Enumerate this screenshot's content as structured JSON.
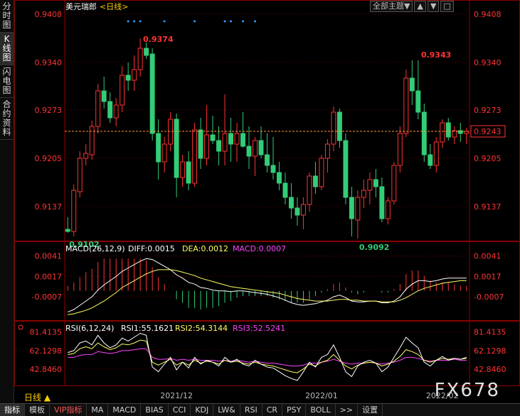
{
  "sidebar": {
    "tabs": [
      {
        "label": "分时图",
        "active": false
      },
      {
        "label": "K线图",
        "active": true
      },
      {
        "label": "闪电图",
        "active": false
      },
      {
        "label": "合约资料",
        "active": false
      }
    ]
  },
  "header": {
    "symbol": "美元瑞郎",
    "period": "<日线>",
    "dropdown_label": "全部主题▼",
    "btn_up": "▲",
    "btn_down": "▼",
    "btn_close": "□"
  },
  "chart_data": [
    {
      "type": "candlestick",
      "yticks": [
        "0.9408",
        "0.9340",
        "0.9273",
        "0.9205",
        "0.9137"
      ],
      "ylim": [
        0.9092,
        0.942
      ],
      "current_price": "0.9243",
      "annotations": {
        "high": "0.9374",
        "high2": "0.9343",
        "low1": "0.9102",
        "low2": "0.9092"
      },
      "xlabels": [
        "2021/12",
        "2022/01",
        "2022/02"
      ],
      "ohlc": [
        [
          0.9105,
          0.9122,
          0.91,
          0.9102
        ],
        [
          0.9102,
          0.9168,
          0.9095,
          0.916
        ],
        [
          0.9158,
          0.9215,
          0.915,
          0.9205
        ],
        [
          0.9205,
          0.9225,
          0.9195,
          0.9212
        ],
        [
          0.921,
          0.9258,
          0.9203,
          0.925
        ],
        [
          0.925,
          0.931,
          0.924,
          0.93
        ],
        [
          0.93,
          0.932,
          0.9275,
          0.9285
        ],
        [
          0.9285,
          0.9298,
          0.9255,
          0.9262
        ],
        [
          0.9262,
          0.929,
          0.925,
          0.928
        ],
        [
          0.928,
          0.9335,
          0.927,
          0.9322
        ],
        [
          0.9322,
          0.934,
          0.93,
          0.9315
        ],
        [
          0.9315,
          0.935,
          0.93,
          0.933
        ],
        [
          0.933,
          0.9374,
          0.932,
          0.936
        ],
        [
          0.936,
          0.9368,
          0.9345,
          0.935
        ],
        [
          0.9352,
          0.936,
          0.923,
          0.924
        ],
        [
          0.924,
          0.926,
          0.9175,
          0.92
        ],
        [
          0.92,
          0.9235,
          0.9185,
          0.9225
        ],
        [
          0.9225,
          0.927,
          0.9215,
          0.926
        ],
        [
          0.926,
          0.9268,
          0.915,
          0.9178
        ],
        [
          0.9178,
          0.921,
          0.9165,
          0.92
        ],
        [
          0.92,
          0.9215,
          0.916,
          0.917
        ],
        [
          0.917,
          0.9255,
          0.9165,
          0.9245
        ],
        [
          0.9245,
          0.9262,
          0.919,
          0.9205
        ],
        [
          0.9205,
          0.928,
          0.9195,
          0.9238
        ],
        [
          0.9238,
          0.9265,
          0.9225,
          0.923
        ],
        [
          0.923,
          0.925,
          0.9195,
          0.9215
        ],
        [
          0.9215,
          0.9295,
          0.9195,
          0.924
        ],
        [
          0.924,
          0.9262,
          0.92,
          0.9225
        ],
        [
          0.9225,
          0.9255,
          0.92,
          0.924
        ],
        [
          0.924,
          0.927,
          0.922,
          0.9222
        ],
        [
          0.9222,
          0.925,
          0.919,
          0.9208
        ],
        [
          0.9208,
          0.9235,
          0.918,
          0.923
        ],
        [
          0.923,
          0.925,
          0.9205,
          0.921
        ],
        [
          0.921,
          0.924,
          0.9185,
          0.9195
        ],
        [
          0.9195,
          0.9235,
          0.9175,
          0.9185
        ],
        [
          0.9185,
          0.92,
          0.916,
          0.917
        ],
        [
          0.917,
          0.9185,
          0.914,
          0.915
        ],
        [
          0.915,
          0.917,
          0.912,
          0.9135
        ],
        [
          0.9135,
          0.915,
          0.911,
          0.9125
        ],
        [
          0.9125,
          0.915,
          0.9105,
          0.914
        ],
        [
          0.914,
          0.9185,
          0.913,
          0.918
        ],
        [
          0.918,
          0.92,
          0.9155,
          0.9165
        ],
        [
          0.9165,
          0.921,
          0.916,
          0.9205
        ],
        [
          0.9205,
          0.9232,
          0.9185,
          0.9225
        ],
        [
          0.9225,
          0.9278,
          0.9215,
          0.927
        ],
        [
          0.927,
          0.9275,
          0.922,
          0.923
        ],
        [
          0.923,
          0.924,
          0.914,
          0.915
        ],
        [
          0.915,
          0.9165,
          0.9095,
          0.912
        ],
        [
          0.9118,
          0.916,
          0.9092,
          0.915
        ],
        [
          0.915,
          0.9175,
          0.9135,
          0.916
        ],
        [
          0.916,
          0.9185,
          0.914,
          0.9175
        ],
        [
          0.9175,
          0.919,
          0.915,
          0.9165
        ],
        [
          0.9165,
          0.9178,
          0.9115,
          0.912
        ],
        [
          0.912,
          0.915,
          0.9112,
          0.9145
        ],
        [
          0.9145,
          0.92,
          0.914,
          0.9195
        ],
        [
          0.9195,
          0.925,
          0.9185,
          0.924
        ],
        [
          0.924,
          0.933,
          0.9235,
          0.9318
        ],
        [
          0.9318,
          0.9343,
          0.928,
          0.93
        ],
        [
          0.93,
          0.9343,
          0.926,
          0.927
        ],
        [
          0.927,
          0.9282,
          0.92,
          0.921
        ],
        [
          0.921,
          0.9225,
          0.919,
          0.9195
        ],
        [
          0.9195,
          0.9235,
          0.9185,
          0.9228
        ],
        [
          0.9228,
          0.926,
          0.922,
          0.9255
        ],
        [
          0.9255,
          0.9262,
          0.923,
          0.9235
        ],
        [
          0.9235,
          0.925,
          0.9225,
          0.9244
        ],
        [
          0.9244,
          0.9255,
          0.9228,
          0.924
        ],
        [
          0.924,
          0.9248,
          0.9225,
          0.9243
        ]
      ]
    },
    {
      "type": "macd",
      "title": "MACD(26,12,9)",
      "diff_label": "DIFF:0.0015",
      "dea_label": "DEA:0.0012",
      "macd_label": "MACD:0.0007",
      "yticks": [
        "0.0041",
        "0.0017",
        "-0.0007"
      ],
      "ylim": [
        -0.0032,
        0.0055
      ],
      "diff": [
        -0.0025,
        -0.0022,
        -0.0017,
        -0.0012,
        -0.0007,
        0.0001,
        0.0007,
        0.0012,
        0.0017,
        0.0023,
        0.0027,
        0.0031,
        0.0035,
        0.0038,
        0.0037,
        0.0033,
        0.0029,
        0.0025,
        0.0019,
        0.0015,
        0.001,
        0.0008,
        0.0004,
        0.0003,
        0.0001,
        0.0,
        0.0,
        -0.0001,
        0.0,
        0.0,
        -0.0001,
        -0.0002,
        -0.0003,
        -0.0004,
        -0.0006,
        -0.0008,
        -0.0011,
        -0.0014,
        -0.0016,
        -0.0017,
        -0.0016,
        -0.0015,
        -0.0013,
        -0.0011,
        -0.0007,
        -0.0005,
        -0.0008,
        -0.0012,
        -0.0013,
        -0.0013,
        -0.0012,
        -0.0012,
        -0.0014,
        -0.0014,
        -0.0012,
        -0.0007,
        0.0002,
        0.0008,
        0.0012,
        0.0012,
        0.0011,
        0.0012,
        0.0014,
        0.0015,
        0.0015,
        0.0015,
        0.0015
      ],
      "dea": [
        -0.0028,
        -0.0027,
        -0.0025,
        -0.0023,
        -0.002,
        -0.0016,
        -0.0012,
        -0.0007,
        -0.0002,
        0.0004,
        0.0008,
        0.0012,
        0.0016,
        0.002,
        0.0023,
        0.0025,
        0.0025,
        0.0025,
        0.0024,
        0.0022,
        0.002,
        0.0018,
        0.0015,
        0.0013,
        0.0011,
        0.0009,
        0.0007,
        0.0005,
        0.0004,
        0.0003,
        0.0002,
        0.0001,
        0.0,
        -0.0001,
        -0.0002,
        -0.0003,
        -0.0005,
        -0.0007,
        -0.0009,
        -0.001,
        -0.0011,
        -0.0012,
        -0.0012,
        -0.0012,
        -0.0011,
        -0.001,
        -0.001,
        -0.0011,
        -0.0011,
        -0.0012,
        -0.0012,
        -0.0012,
        -0.0013,
        -0.0013,
        -0.0013,
        -0.0011,
        -0.0008,
        -0.0004,
        0.0,
        0.0003,
        0.0005,
        0.0007,
        0.0009,
        0.001,
        0.0011,
        0.0012,
        0.0012
      ]
    },
    {
      "type": "rsi",
      "title": "RSI(6,12,24)",
      "rsi1_label": "RSI1:55.1621",
      "rsi2_label": "RSI2:54.3144",
      "rsi3_label": "RSI3:52.5241",
      "yticks": [
        "81.4135",
        "62.1298",
        "42.8460"
      ],
      "ylim": [
        28,
        90
      ],
      "rsi1": [
        60,
        62,
        70,
        72,
        68,
        78,
        70,
        65,
        68,
        75,
        72,
        76,
        80,
        78,
        45,
        40,
        48,
        55,
        42,
        50,
        44,
        55,
        48,
        52,
        50,
        46,
        55,
        50,
        53,
        48,
        46,
        52,
        48,
        45,
        44,
        40,
        36,
        33,
        31,
        40,
        50,
        45,
        55,
        58,
        68,
        55,
        40,
        35,
        46,
        50,
        52,
        49,
        40,
        45,
        55,
        65,
        76,
        70,
        65,
        50,
        46,
        52,
        56,
        52,
        54,
        53,
        55
      ],
      "rsi2": [
        58,
        59,
        64,
        66,
        64,
        70,
        66,
        63,
        65,
        69,
        68,
        70,
        73,
        72,
        50,
        47,
        50,
        53,
        47,
        50,
        47,
        52,
        49,
        51,
        50,
        48,
        52,
        50,
        51,
        49,
        48,
        50,
        48,
        47,
        46,
        44,
        42,
        40,
        39,
        43,
        48,
        46,
        50,
        52,
        58,
        52,
        46,
        43,
        47,
        49,
        50,
        49,
        46,
        48,
        51,
        56,
        63,
        61,
        58,
        52,
        50,
        52,
        54,
        53,
        54,
        53,
        54
      ],
      "rsi3": [
        55,
        55,
        57,
        58,
        58,
        61,
        60,
        59,
        60,
        62,
        62,
        63,
        64,
        64,
        55,
        53,
        53,
        54,
        52,
        53,
        52,
        53,
        52,
        52,
        52,
        51,
        52,
        51,
        52,
        51,
        50,
        51,
        50,
        49,
        49,
        48,
        47,
        46,
        46,
        47,
        49,
        49,
        50,
        51,
        53,
        51,
        49,
        48,
        49,
        49,
        50,
        49,
        48,
        49,
        50,
        52,
        55,
        55,
        54,
        52,
        51,
        52,
        52,
        52,
        53,
        52,
        52
      ]
    }
  ],
  "bottom_tabs": [
    "指标",
    "模板",
    "VIP指标",
    "MA",
    "MACD",
    "BIAS",
    "CCI",
    "KDJ",
    "LW&",
    "RSI",
    "CR",
    "PSY",
    "BOLL",
    ">>",
    "设置"
  ],
  "period_label": "日线 ▲",
  "watermark": "FX678"
}
